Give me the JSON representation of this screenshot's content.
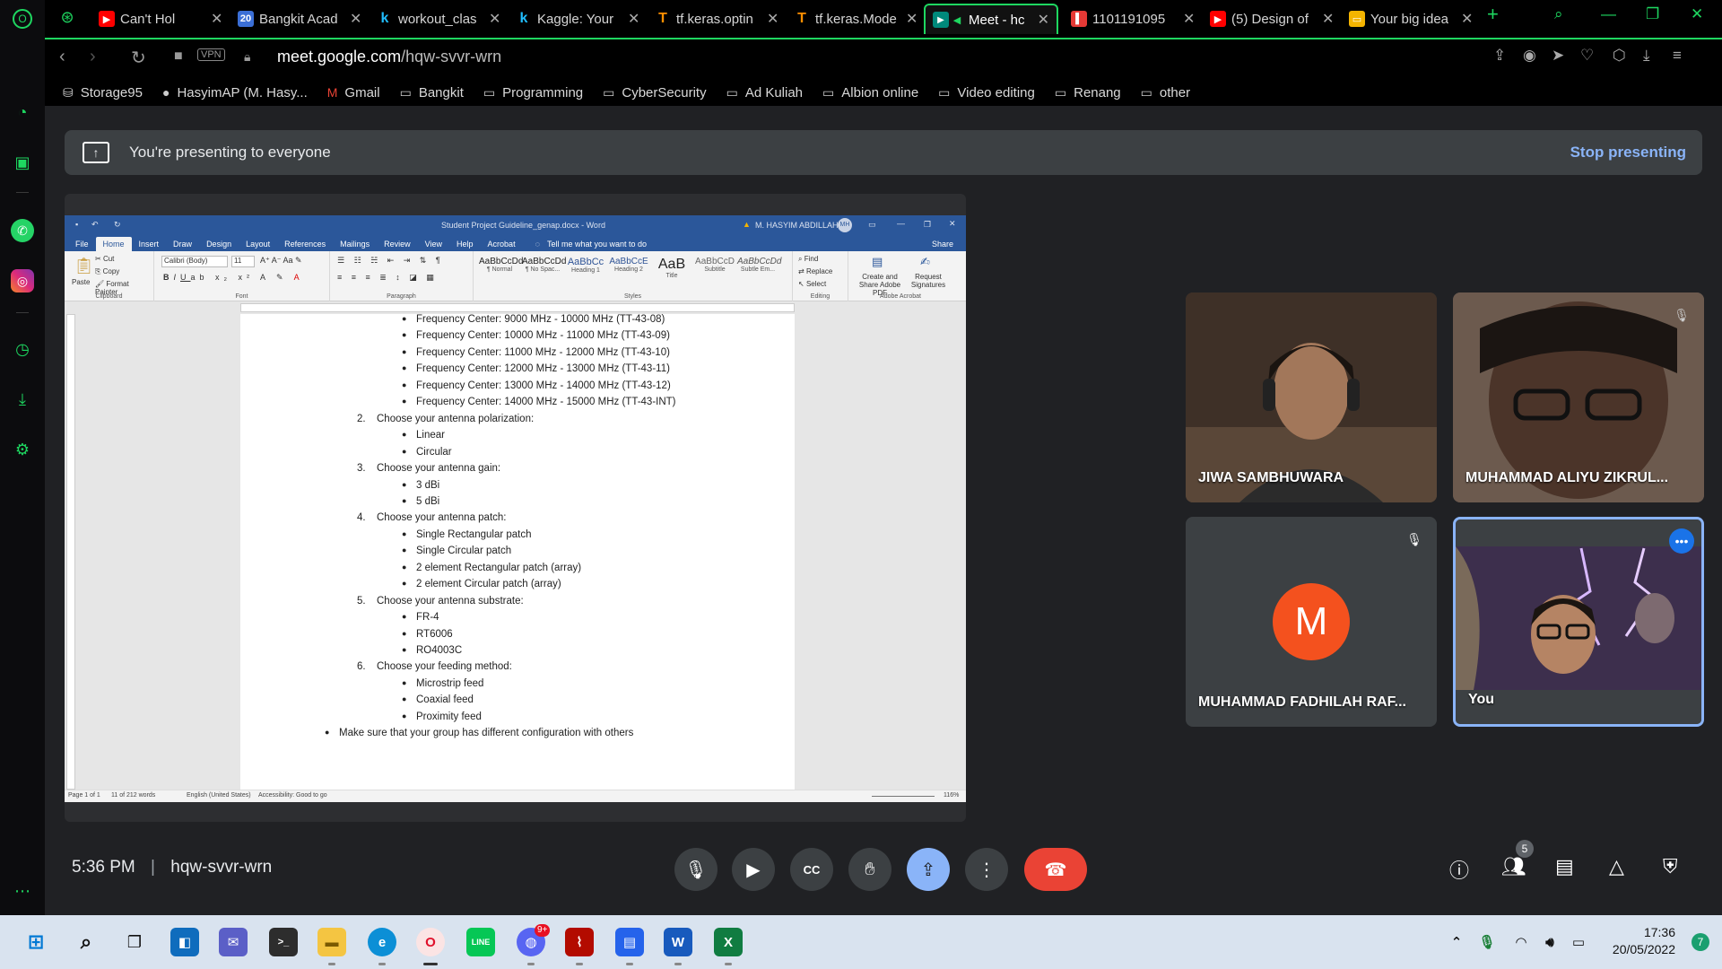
{
  "browser": {
    "tabs": [
      {
        "title": "Can't Hol",
        "favicon": "youtube-icon",
        "color": "#ff0000"
      },
      {
        "title": "Bangkit Acad",
        "favicon": "bangkit-icon",
        "color": "#3b6fd6"
      },
      {
        "title": "workout_clas",
        "favicon": "kaggle-icon",
        "color": "#20beff"
      },
      {
        "title": "Kaggle: Your",
        "favicon": "kaggle-icon",
        "color": "#20beff"
      },
      {
        "title": "tf.keras.optin",
        "favicon": "tensorflow-icon",
        "color": "#ff8f00"
      },
      {
        "title": "tf.keras.Mode",
        "favicon": "tensorflow-icon",
        "color": "#ff8f00"
      },
      {
        "title": "Meet - hc",
        "favicon": "meet-icon",
        "color": "#00897b"
      },
      {
        "title": "1101191095",
        "favicon": "telkom-icon",
        "color": "#e53935"
      },
      {
        "title": "(5) Design of",
        "favicon": "youtube-icon",
        "color": "#ff0000"
      },
      {
        "title": "Your big idea",
        "favicon": "slides-icon",
        "color": "#f4b400"
      }
    ],
    "url_domain": "meet.google.com",
    "url_path": "/hqw-svvr-wrn",
    "vpn_label": "VPN",
    "bookmarks": [
      {
        "label": "Storage95",
        "icon": "storage-icon"
      },
      {
        "label": "HasyimAP (M. Hasy...",
        "icon": "github-icon"
      },
      {
        "label": "Gmail",
        "icon": "gmail-icon"
      },
      {
        "label": "Bangkit",
        "icon": "folder-icon"
      },
      {
        "label": "Programming",
        "icon": "folder-icon"
      },
      {
        "label": "CyberSecurity",
        "icon": "folder-icon"
      },
      {
        "label": "Ad Kuliah",
        "icon": "folder-icon"
      },
      {
        "label": "Albion online",
        "icon": "folder-icon"
      },
      {
        "label": "Video editing",
        "icon": "folder-icon"
      },
      {
        "label": "Renang",
        "icon": "folder-icon"
      },
      {
        "label": "other",
        "icon": "folder-icon"
      }
    ]
  },
  "meet": {
    "banner_text": "You're presenting to everyone",
    "stop_label": "Stop presenting",
    "time": "5:36 PM",
    "meeting_code": "hqw-svvr-wrn",
    "participants_count": "5",
    "participants": [
      {
        "name": "JIWA SAMBHUWARA"
      },
      {
        "name": "MUHAMMAD ALIYU ZIKRUL..."
      },
      {
        "name": "MUHAMMAD FADHILAH RAF...",
        "initial": "M"
      },
      {
        "name": "You"
      }
    ]
  },
  "word": {
    "title": "Student Project Guideline_genap.docx - Word",
    "user": "M. HASYIM ABDILLAH P.",
    "user_initials": "MH",
    "tabs": [
      "File",
      "Home",
      "Insert",
      "Draw",
      "Design",
      "Layout",
      "References",
      "Mailings",
      "Review",
      "View",
      "Help",
      "Acrobat"
    ],
    "tell_me": "Tell me what you want to do",
    "share": "Share",
    "clipboard": {
      "paste": "Paste",
      "cut": "Cut",
      "copy": "Copy",
      "painter": "Format Painter",
      "label": "Clipboard"
    },
    "font": {
      "name": "Calibri (Body)",
      "size": "11",
      "label": "Font"
    },
    "paragraph_label": "Paragraph",
    "styles": [
      {
        "sample": "AaBbCcDd",
        "name": "¶ Normal"
      },
      {
        "sample": "AaBbCcDd",
        "name": "¶ No Spac..."
      },
      {
        "sample": "AaBbCc",
        "name": "Heading 1"
      },
      {
        "sample": "AaBbCcE",
        "name": "Heading 2"
      },
      {
        "sample": "AaB",
        "name": "Title"
      },
      {
        "sample": "AaBbCcD",
        "name": "Subtitle"
      },
      {
        "sample": "AaBbCcDd",
        "name": "Subtle Em..."
      }
    ],
    "styles_label": "Styles",
    "editing": {
      "find": "Find",
      "replace": "Replace",
      "select": "Select",
      "label": "Editing"
    },
    "acrobat": {
      "create": "Create and Share Adobe PDF",
      "request": "Request Signatures",
      "label": "Adobe Acrobat"
    },
    "status": {
      "page": "Page 1 of 1",
      "words": "11 of 212 words",
      "language": "English (United States)",
      "accessibility": "Accessibility: Good to go",
      "zoom": "116%"
    },
    "doc_lines": [
      {
        "text": "Frequency Center: 9000 MHz - 10000 MHz (TT-43-08)",
        "level": 2
      },
      {
        "text": "Frequency Center: 10000 MHz - 11000 MHz (TT-43-09)",
        "level": 2
      },
      {
        "text": "Frequency Center: 11000 MHz - 12000 MHz (TT-43-10)",
        "level": 2
      },
      {
        "text": "Frequency Center: 12000 MHz - 13000 MHz (TT-43-11)",
        "level": 2
      },
      {
        "text": "Frequency Center: 13000 MHz - 14000 MHz (TT-43-12)",
        "level": 2
      },
      {
        "text": "Frequency Center: 14000 MHz - 15000 MHz (TT-43-INT)",
        "level": 2
      },
      {
        "text": "Choose your antenna polarization:",
        "level": 1,
        "num": "2."
      },
      {
        "text": "Linear",
        "level": 2
      },
      {
        "text": "Circular",
        "level": 2
      },
      {
        "text": "Choose your antenna gain:",
        "level": 1,
        "num": "3."
      },
      {
        "text": "3 dBi",
        "level": 2
      },
      {
        "text": "5 dBi",
        "level": 2
      },
      {
        "text": "Choose your antenna patch:",
        "level": 1,
        "num": "4."
      },
      {
        "text": "Single Rectangular patch",
        "level": 2
      },
      {
        "text": "Single Circular patch",
        "level": 2
      },
      {
        "text": "2 element Rectangular patch (array)",
        "level": 2
      },
      {
        "text": "2 element Circular patch (array)",
        "level": 2
      },
      {
        "text": "Choose your antenna substrate:",
        "level": 1,
        "num": "5."
      },
      {
        "text": "FR-4",
        "level": 2
      },
      {
        "text": "RT6006",
        "level": 2
      },
      {
        "text": "RO4003C",
        "level": 2
      },
      {
        "text": "Choose your feeding method:",
        "level": 1,
        "num": "6."
      },
      {
        "text": "Microstrip feed",
        "level": 2
      },
      {
        "text": "Coaxial feed",
        "level": 2
      },
      {
        "text": "Proximity feed",
        "level": 2
      },
      {
        "text": "Make sure that your group has different configuration with others",
        "level": 0
      }
    ]
  },
  "taskbar": {
    "time": "17:36",
    "date": "20/05/2022",
    "notifications": "7",
    "discord_badge": "9+"
  },
  "colors": {
    "opera_accent": "#1ed760",
    "meet_bg": "#202124",
    "meet_blue": "#8ab4f8",
    "end_call_red": "#ea4335",
    "word_blue": "#2b579a",
    "avatar_orange": "#f4511e"
  }
}
